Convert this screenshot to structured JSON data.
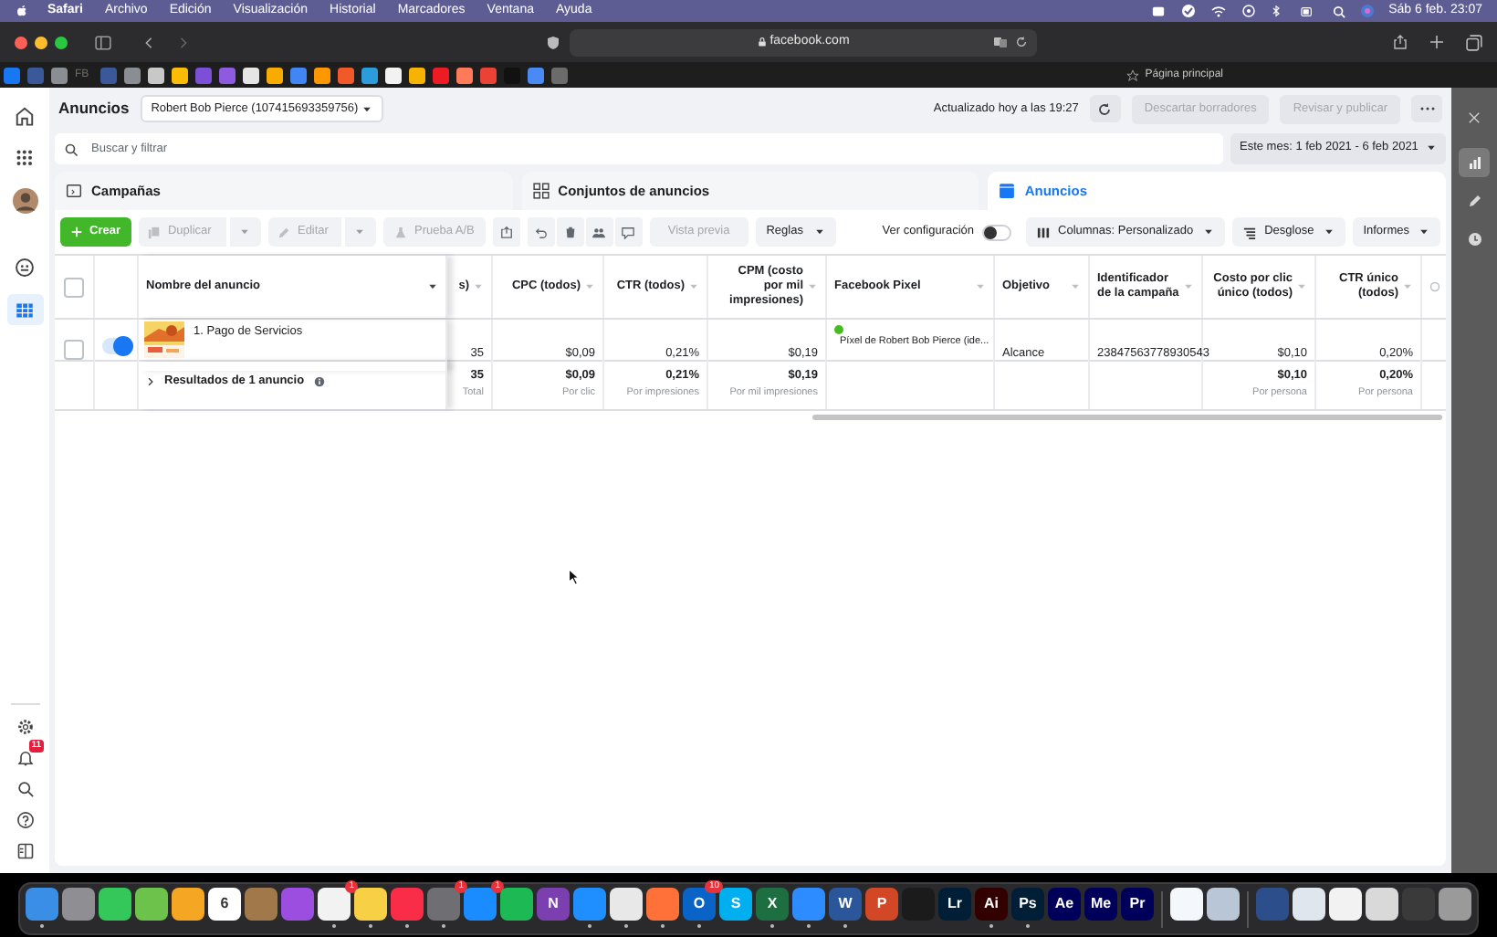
{
  "menubar": {
    "app": "Safari",
    "menus": [
      "Archivo",
      "Edición",
      "Visualización",
      "Historial",
      "Marcadores",
      "Ventana",
      "Ayuda"
    ],
    "clock": "Sáb 6 feb. 23:07"
  },
  "browser": {
    "address": "facebook.com",
    "favorites": "Página principal",
    "bookmarks": [
      {
        "color": "#1877f2"
      },
      {
        "color": "#3b5998"
      },
      {
        "color": "#8a8d91"
      },
      {
        "color": "#6b6b6b",
        "label": "FB"
      },
      {
        "color": "#3b5998"
      },
      {
        "color": "#8a8d91"
      },
      {
        "color": "#c8c8c8"
      },
      {
        "color": "#fbbc04"
      },
      {
        "color": "#7b4fd6"
      },
      {
        "color": "#8e5be0"
      },
      {
        "color": "#e5e5e5"
      },
      {
        "color": "#f9ab00"
      },
      {
        "color": "#4285f4"
      },
      {
        "color": "#ff9800"
      },
      {
        "color": "#f05a28"
      },
      {
        "color": "#2d9cdb"
      },
      {
        "color": "#f2f2f2"
      },
      {
        "color": "#f6b400"
      },
      {
        "color": "#ed1c24"
      },
      {
        "color": "#ff7a59"
      },
      {
        "color": "#ea4335"
      },
      {
        "color": "#111111"
      },
      {
        "color": "#4a8af4"
      },
      {
        "color": "#6b6b6b"
      }
    ]
  },
  "nav": {
    "top": [
      {
        "kind": "home",
        "selected": false
      },
      {
        "kind": "apps",
        "selected": false
      },
      {
        "kind": "avatar",
        "selected": false
      },
      {
        "kind": "smiley",
        "selected": false
      },
      {
        "kind": "table",
        "selected": true
      }
    ],
    "bottom": [
      {
        "kind": "gear"
      },
      {
        "kind": "bell",
        "badge": "11"
      },
      {
        "kind": "search"
      },
      {
        "kind": "help"
      },
      {
        "kind": "panel"
      }
    ]
  },
  "header": {
    "title": "Anuncios",
    "account": "Robert Bob Pierce (107415693359756)",
    "updated": "Actualizado hoy a las 19:27",
    "buttons": [
      {
        "label": "Descartar borradores",
        "disabled": true
      },
      {
        "label": "Revisar y publicar",
        "disabled": true
      }
    ]
  },
  "search": {
    "placeholder": "Buscar y filtrar",
    "date_range": "Este mes: 1 feb 2021 - 6 feb 2021"
  },
  "tabs": [
    {
      "kind": "folder",
      "label": "Campañas",
      "selected": false
    },
    {
      "kind": "grid",
      "label": "Conjuntos de anuncios",
      "selected": false
    },
    {
      "kind": "square",
      "label": "Anuncios",
      "selected": true
    }
  ],
  "toolbar": {
    "create": "Crear",
    "left": [
      {
        "label": "Duplicar",
        "split": true,
        "disabled": true
      },
      {
        "label": "Editar",
        "split": true,
        "disabled": true
      },
      {
        "label": "Prueba A/B",
        "split": false,
        "disabled": true
      }
    ],
    "preview": {
      "label": "Vista previa",
      "disabled": true
    },
    "rules": "Reglas",
    "settings": {
      "label": "Ver configuración",
      "on": false
    },
    "right": [
      {
        "kind": "columns",
        "label": "Columnas: Personalizado"
      },
      {
        "kind": "breakdown",
        "label": "Desglose"
      },
      {
        "kind": "plain",
        "label": "Informes"
      }
    ]
  },
  "table": {
    "select_all": {
      "checked": false
    },
    "columns": [
      {
        "label": "Nombre del anuncio",
        "numeric": false
      },
      {
        "label": "s)",
        "numeric": true
      },
      {
        "label": "CPC (todos)",
        "numeric": true
      },
      {
        "label": "CTR (todos)",
        "numeric": true
      },
      {
        "label": "CPM (costo por mil impresiones)",
        "numeric": true
      },
      {
        "label": "Facebook Pixel",
        "numeric": false
      },
      {
        "label": "Objetivo",
        "numeric": false
      },
      {
        "label": "Identificador de la campaña",
        "numeric": false
      },
      {
        "label": "Costo por clic único (todos)",
        "numeric": true
      },
      {
        "label": "CTR único (todos)",
        "numeric": true
      }
    ],
    "rows": [
      {
        "checked": false,
        "on": true,
        "cells": [
          "1. Pago de Servicios",
          "35",
          "$0,09",
          "0,21%",
          "$0,19",
          {
            "color": "#45bd1f",
            "text": "Píxel de Robert Bob Pierce (ide..."
          },
          "Alcance",
          "23847563778930543",
          "$0,10",
          "0,20%"
        ]
      }
    ],
    "summary": {
      "label": "Resultados de 1 anuncio",
      "cells": [
        {
          "value": "35",
          "note": "Total"
        },
        {
          "value": "$0,09",
          "note": "Por clic"
        },
        {
          "value": "0,21%",
          "note": "Por impresiones"
        },
        {
          "value": "$0,19",
          "note": "Por mil impresiones"
        },
        null,
        null,
        null,
        {
          "value": "$0,10",
          "note": "Por persona"
        },
        {
          "value": "0,20%",
          "note": "Por persona"
        }
      ]
    }
  },
  "side_panel": [
    {
      "kind": "close",
      "selected": false
    },
    {
      "kind": "chart",
      "selected": true
    },
    {
      "kind": "pencil",
      "selected": false
    },
    {
      "kind": "clock",
      "selected": false
    }
  ],
  "dock": [
    {
      "kind": "app",
      "color": "#3a8ee6",
      "running": true
    },
    {
      "kind": "app",
      "color": "#8e8e93",
      "running": false
    },
    {
      "kind": "app",
      "color": "#34c759",
      "running": false
    },
    {
      "kind": "app",
      "color": "#6cc24a",
      "running": false
    },
    {
      "kind": "app",
      "color": "#f5a623",
      "running": false
    },
    {
      "kind": "app",
      "color": "#ffffff",
      "label": "6",
      "running": false
    },
    {
      "kind": "app",
      "color": "#a0784a",
      "running": false
    },
    {
      "kind": "app",
      "color": "#9b4ee0",
      "running": false
    },
    {
      "kind": "app",
      "color": "#f2f2f2",
      "badge": "1",
      "running": true
    },
    {
      "kind": "app",
      "color": "#f7d046",
      "running": true
    },
    {
      "kind": "app",
      "color": "#fa2d48",
      "running": true
    },
    {
      "kind": "app",
      "color": "#6e6e73",
      "badge": "1",
      "running": true
    },
    {
      "kind": "app",
      "color": "#1a8cff",
      "badge": "1",
      "running": false
    },
    {
      "kind": "app",
      "color": "#1db954",
      "running": false
    },
    {
      "kind": "app",
      "color": "#7b3fb0",
      "label": "N",
      "running": false
    },
    {
      "kind": "app",
      "color": "#1f8fff",
      "running": true
    },
    {
      "kind": "app",
      "color": "#e8e8e8",
      "running": true
    },
    {
      "kind": "app",
      "color": "#ff7139",
      "running": true
    },
    {
      "kind": "app",
      "color": "#0a64c8",
      "label": "O",
      "badge": "10",
      "running": true
    },
    {
      "kind": "app",
      "color": "#00aff0",
      "label": "S",
      "running": false
    },
    {
      "kind": "app",
      "color": "#1d6f42",
      "label": "X",
      "running": true
    },
    {
      "kind": "app",
      "color": "#2d8cff",
      "running": true
    },
    {
      "kind": "app",
      "color": "#2b579a",
      "label": "W",
      "running": true
    },
    {
      "kind": "app",
      "color": "#d24726",
      "label": "P",
      "running": false
    },
    {
      "kind": "app",
      "color": "#1b1b1b",
      "running": false
    },
    {
      "kind": "app",
      "color": "#001e36",
      "label": "Lr",
      "running": false
    },
    {
      "kind": "app",
      "color": "#330000",
      "label": "Ai",
      "running": true
    },
    {
      "kind": "app",
      "color": "#001e36",
      "label": "Ps",
      "running": true
    },
    {
      "kind": "app",
      "color": "#00005b",
      "label": "Ae",
      "running": false
    },
    {
      "kind": "app",
      "color": "#00005b",
      "label": "Me",
      "running": false
    },
    {
      "kind": "app",
      "color": "#00005b",
      "label": "Pr",
      "running": false
    },
    {
      "kind": "separator"
    },
    {
      "kind": "app",
      "color": "#f4f8fc",
      "running": false
    },
    {
      "kind": "app",
      "color": "#b9c6d6",
      "running": false
    },
    {
      "kind": "separator"
    },
    {
      "kind": "app",
      "color": "#2c4f8c",
      "running": false
    },
    {
      "kind": "app",
      "color": "#dfe6ee",
      "running": false
    },
    {
      "kind": "app",
      "color": "#f2f2f2",
      "running": false
    },
    {
      "kind": "app",
      "color": "#d9d9d9",
      "running": false
    },
    {
      "kind": "app",
      "color": "#3a3a3a",
      "running": false
    },
    {
      "kind": "app",
      "color": "#9a9a9a",
      "running": false
    }
  ]
}
